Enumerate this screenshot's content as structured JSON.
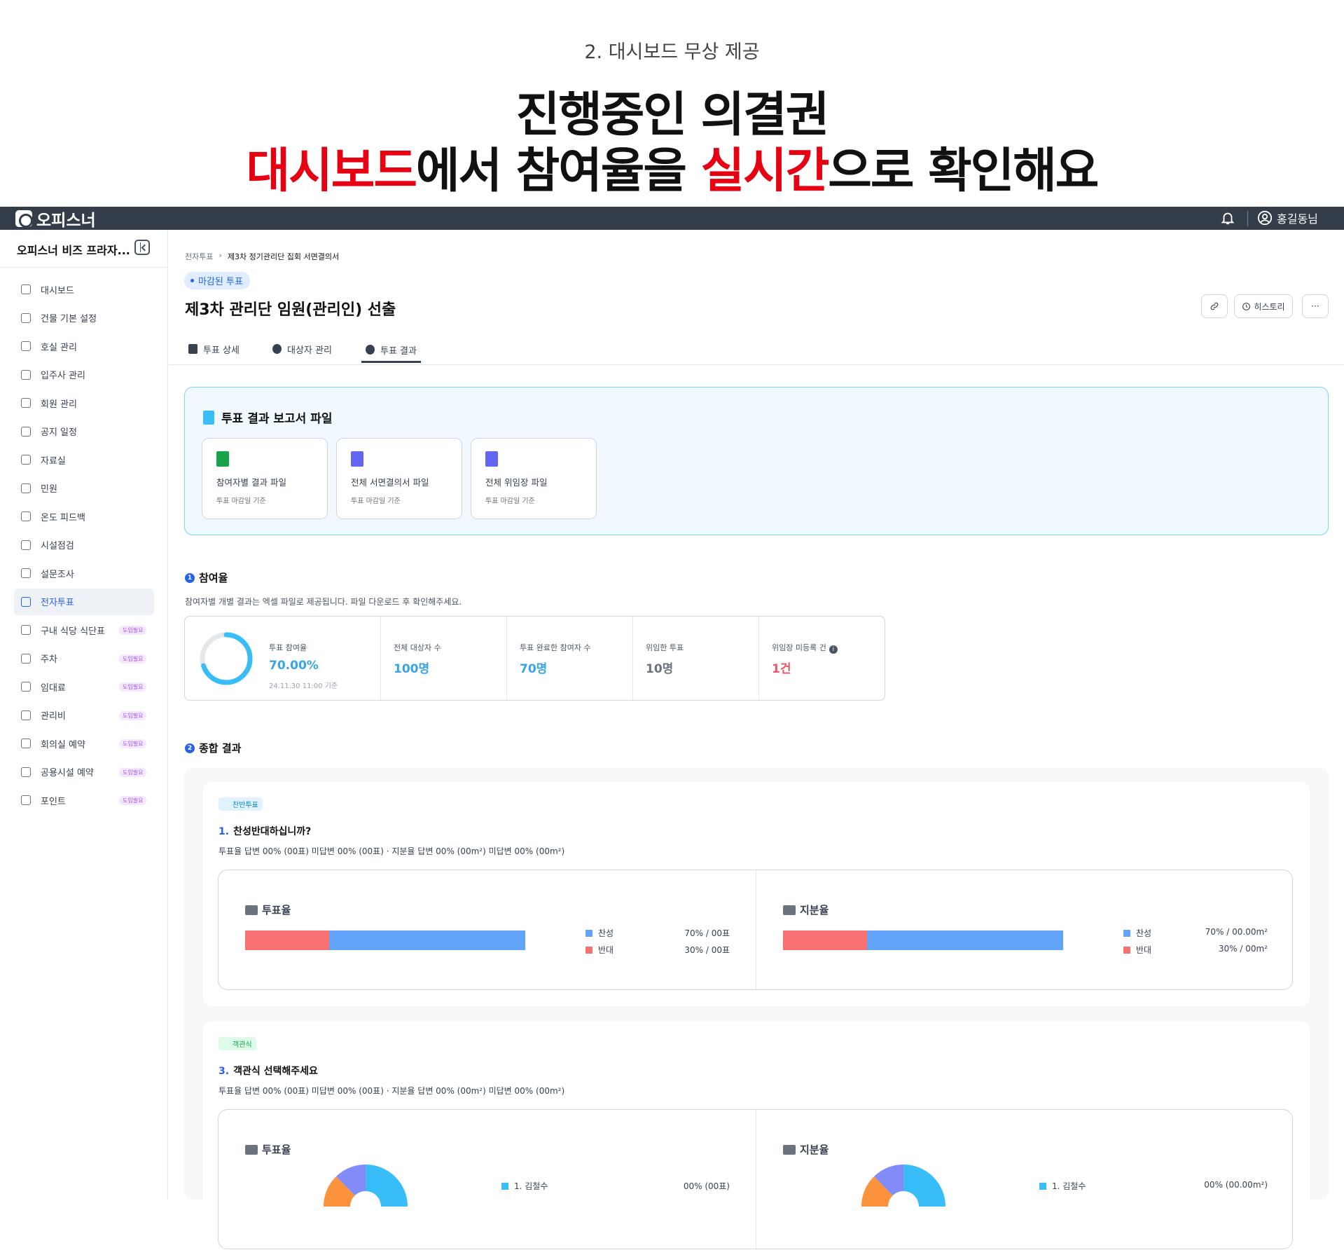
{
  "promo": {
    "subtitle": "2. 대시보드 무상 제공",
    "headline1": "진행중인 의결권",
    "headline2_red1": "대시보드",
    "headline2_mid": "에서 참여율을 ",
    "headline2_red2": "실시간",
    "headline2_end": "으로 확인해요"
  },
  "topbar": {
    "logo": "오피스너",
    "user": "홍길동님"
  },
  "sidebar": {
    "workspace": "오피스너 비즈 프라자...",
    "items": [
      {
        "label": "대시보드",
        "badge": ""
      },
      {
        "label": "건물 기본 설정",
        "badge": ""
      },
      {
        "label": "호실 관리",
        "badge": ""
      },
      {
        "label": "입주사 관리",
        "badge": ""
      },
      {
        "label": "회원 관리",
        "badge": ""
      },
      {
        "label": "공지 일정",
        "badge": ""
      },
      {
        "label": "자료실",
        "badge": ""
      },
      {
        "label": "민원",
        "badge": ""
      },
      {
        "label": "온도 피드백",
        "badge": ""
      },
      {
        "label": "시설점검",
        "badge": ""
      },
      {
        "label": "설문조사",
        "badge": ""
      },
      {
        "label": "전자투표",
        "badge": ""
      },
      {
        "label": "구내 식당 식단표",
        "badge": "도입필요"
      },
      {
        "label": "주차",
        "badge": "도입필요"
      },
      {
        "label": "임대료",
        "badge": "도입필요"
      },
      {
        "label": "관리비",
        "badge": "도입필요"
      },
      {
        "label": "회의실 예약",
        "badge": "도입필요"
      },
      {
        "label": "공용시설 예약",
        "badge": "도입필요"
      },
      {
        "label": "포인트",
        "badge": "도입필요"
      }
    ]
  },
  "breadcrumb": {
    "parent": "전자투표",
    "current": "제3차 정기관리단 집회 서면결의서"
  },
  "status": "마감된 투표",
  "title": "제3차 관리단 임원(관리인) 선출",
  "buttons": {
    "history": "히스토리",
    "more": "···"
  },
  "tabs": [
    "투표 상세",
    "대상자 관리",
    "투표 결과"
  ],
  "report": {
    "title": "투표 결과 보고서 파일",
    "files": [
      {
        "name": "참여자별 결과 파일",
        "sub": "투표 마감일 기준",
        "color": "#16a34a"
      },
      {
        "name": "전체 서면결의서 파일",
        "sub": "투표 마감일 기준",
        "color": "#6366f1"
      },
      {
        "name": "전체 위임장 파일",
        "sub": "투표 마감일 기준",
        "color": "#6366f1"
      }
    ]
  },
  "participation": {
    "num": "1",
    "heading": "참여율",
    "desc": "참여자별 개별 결과는 엑셀 파일로 제공됩니다. 파일 다운로드 후 확인해주세요.",
    "rate": 0.7,
    "rate_label": "투표 참여율",
    "rate_value": "70.00%",
    "rate_note": "24.11.30 11:00 기준",
    "cells": [
      {
        "label": "전체 대상자 수",
        "value": "100명",
        "color": "#38a4e8"
      },
      {
        "label": "투표 완료한 참여자 수",
        "value": "70명",
        "color": "#38a4e8"
      },
      {
        "label": "위임한 투표",
        "value": "10명",
        "color": "#6b7280"
      },
      {
        "label": "위임장 미등록 건",
        "value": "1건",
        "color": "#f0546a"
      }
    ],
    "info_icon": "i"
  },
  "summary": {
    "num": "2",
    "heading": "종합 결과",
    "q1": {
      "badge": "찬반투표",
      "num": "1.",
      "title": "찬성반대하십니까?",
      "desc": "투표율 답변 00% (00표) 미답변 00% (00표)  ·  지분율 답변 00% (00m²)  미답변 00% (00m²)",
      "panels": [
        {
          "title": "투표율",
          "legend": [
            {
              "label": "찬성",
              "value": "70% / 00표",
              "pct": 70,
              "color": "#60a5fa"
            },
            {
              "label": "반대",
              "value": "30% / 00표",
              "pct": 30,
              "color": "#f87171"
            }
          ]
        },
        {
          "title": "지분율",
          "legend": [
            {
              "label": "찬성",
              "value": "70% / 00.00m²",
              "pct": 70,
              "color": "#60a5fa"
            },
            {
              "label": "반대",
              "value": "30% / 00m²",
              "pct": 30,
              "color": "#f87171"
            }
          ]
        }
      ]
    },
    "q3": {
      "badge": "객관식",
      "num": "3.",
      "title": "객관식 선택해주세요",
      "desc": "투표율 답변 00% (00표) 미답변 00% (00표)  ·  지분율 답변 00% (00m²)  미답변 00% (00m²)",
      "panels": [
        {
          "title": "투표율",
          "legend": [
            {
              "label": "1. 김철수",
              "value": "00% (00표)"
            }
          ]
        },
        {
          "title": "지분율",
          "legend": [
            {
              "label": "1. 김철수",
              "value": "00% (00.00m²)"
            }
          ]
        }
      ]
    }
  }
}
